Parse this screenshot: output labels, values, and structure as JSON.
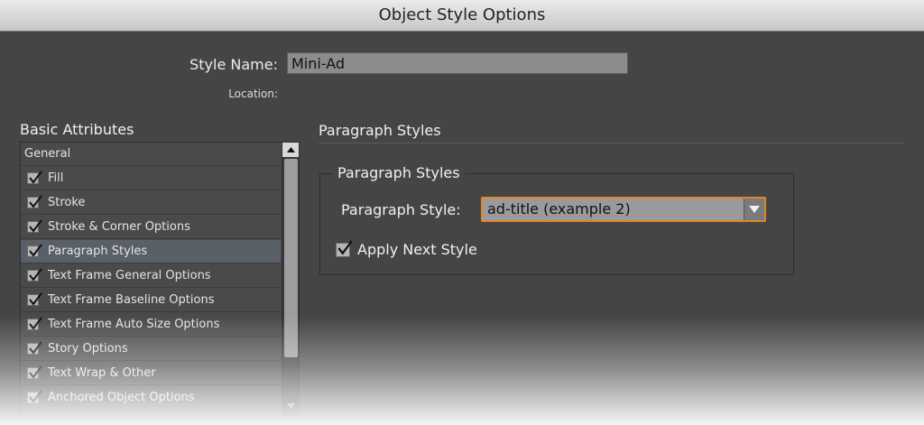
{
  "window": {
    "title": "Object Style Options"
  },
  "style_name": {
    "label": "Style Name:",
    "value": "Mini-Ad"
  },
  "location": {
    "label": "Location:"
  },
  "basic_attributes": {
    "heading": "Basic Attributes",
    "items": [
      {
        "label": "General",
        "checked": null,
        "selected": false
      },
      {
        "label": "Fill",
        "checked": true,
        "selected": false
      },
      {
        "label": "Stroke",
        "checked": true,
        "selected": false
      },
      {
        "label": "Stroke & Corner Options",
        "checked": true,
        "selected": false
      },
      {
        "label": "Paragraph Styles",
        "checked": true,
        "selected": true
      },
      {
        "label": "Text Frame General Options",
        "checked": true,
        "selected": false
      },
      {
        "label": "Text Frame Baseline Options",
        "checked": true,
        "selected": false
      },
      {
        "label": "Text Frame Auto Size Options",
        "checked": true,
        "selected": false
      },
      {
        "label": "Story Options",
        "checked": true,
        "selected": false
      },
      {
        "label": "Text Wrap & Other",
        "checked": true,
        "selected": false
      },
      {
        "label": "Anchored Object Options",
        "checked": true,
        "selected": false
      }
    ]
  },
  "panel": {
    "heading": "Paragraph Styles",
    "group_title": "Paragraph Styles",
    "paragraph_style_label": "Paragraph Style:",
    "paragraph_style_value": "ad-title (example 2)",
    "apply_next_label": "Apply Next Style",
    "apply_next_checked": true
  },
  "icons": {
    "checkmark": "checkmark-icon",
    "dropdown": "triangle-down-icon",
    "scroll_up": "scroll-up-arrow-icon",
    "scroll_down": "scroll-down-arrow-icon"
  },
  "colors": {
    "background": "#454545",
    "focus_ring": "#e0852a",
    "selection": "#5a6068"
  }
}
